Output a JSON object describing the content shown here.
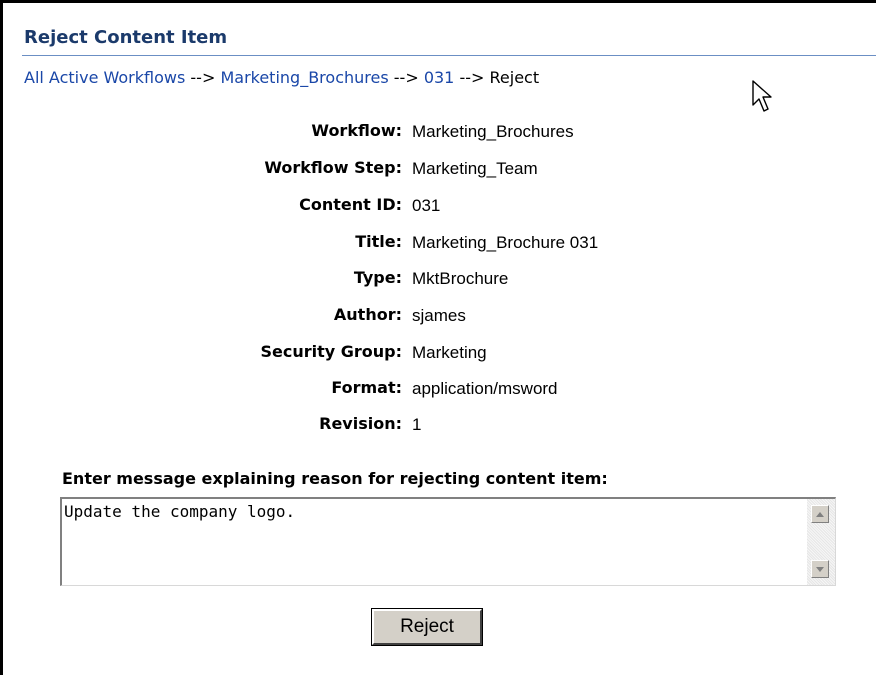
{
  "header": {
    "title": "Reject Content Item"
  },
  "breadcrumb": {
    "items": [
      "All Active Workflows",
      "Marketing_Brochures",
      "031"
    ],
    "separator": "-->",
    "current": "Reject"
  },
  "details": [
    {
      "label": "Workflow:",
      "value": "Marketing_Brochures"
    },
    {
      "label": "Workflow Step:",
      "value": "Marketing_Team"
    },
    {
      "label": "Content ID:",
      "value": "031"
    },
    {
      "label": "Title:",
      "value": "Marketing_Brochure 031"
    },
    {
      "label": "Type:",
      "value": "MktBrochure"
    },
    {
      "label": "Author:",
      "value": "sjames"
    },
    {
      "label": "Security Group:",
      "value": "Marketing"
    },
    {
      "label": "Format:",
      "value": "application/msword"
    },
    {
      "label": "Revision:",
      "value": "1"
    }
  ],
  "form": {
    "reason_label": "Enter message explaining reason for rejecting content item:",
    "reason_value": "Update the company logo.",
    "submit_label": "Reject"
  },
  "colors": {
    "title": "#1b3a6b",
    "link": "#1a47a8",
    "rule": "#6b8fc4",
    "button_face": "#d4d0c8"
  },
  "icons": {
    "cursor": "mouse-pointer-icon",
    "scroll_up": "scroll-up-arrow-icon",
    "scroll_down": "scroll-down-arrow-icon"
  }
}
